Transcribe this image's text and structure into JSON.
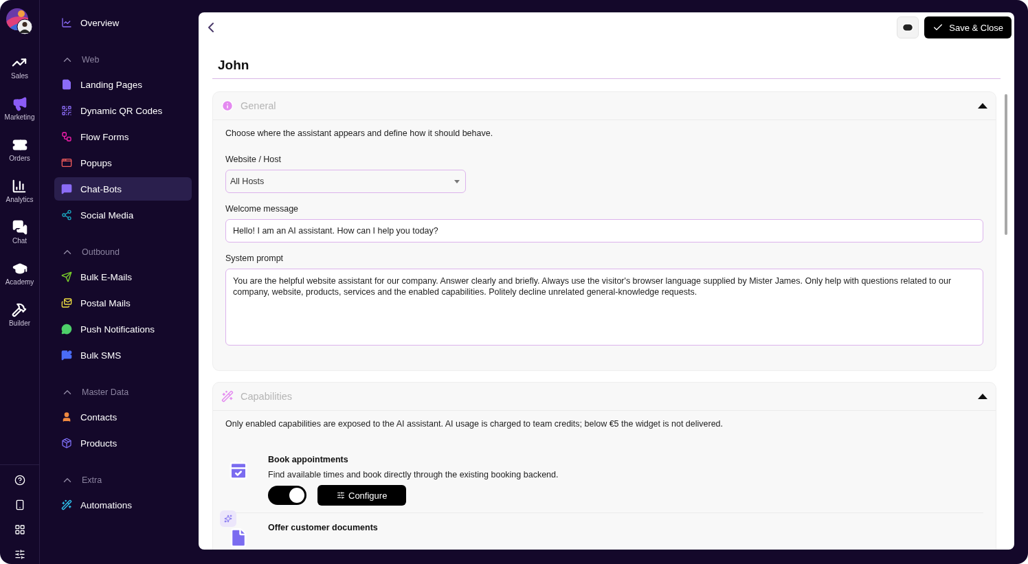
{
  "rail": {
    "items": [
      {
        "kind": "sales",
        "label": "Sales"
      },
      {
        "kind": "marketing",
        "label": "Marketing"
      },
      {
        "kind": "orders",
        "label": "Orders"
      },
      {
        "kind": "analytics",
        "label": "Analytics"
      },
      {
        "kind": "chat",
        "label": "Chat"
      },
      {
        "kind": "academy",
        "label": "Academy"
      },
      {
        "kind": "builder",
        "label": "Builder"
      }
    ],
    "bottom": [
      {
        "kind": "help"
      },
      {
        "kind": "phone"
      },
      {
        "kind": "apps"
      },
      {
        "kind": "sliders"
      }
    ]
  },
  "nav": [
    {
      "kind": "overview",
      "label": "Overview",
      "selected": false
    },
    {
      "kind": "group",
      "label": "Web",
      "expanded": true,
      "children": [
        {
          "kind": "landing",
          "label": "Landing Pages",
          "selected": false
        },
        {
          "kind": "qr",
          "label": "Dynamic QR Codes",
          "selected": false
        },
        {
          "kind": "flow",
          "label": "Flow Forms",
          "selected": false
        },
        {
          "kind": "popup",
          "label": "Popups",
          "selected": false
        },
        {
          "kind": "chatbot",
          "label": "Chat-Bots",
          "selected": true
        },
        {
          "kind": "social",
          "label": "Social Media",
          "selected": false
        }
      ]
    },
    {
      "kind": "group",
      "label": "Outbound",
      "expanded": true,
      "children": [
        {
          "kind": "email",
          "label": "Bulk E-Mails",
          "selected": false
        },
        {
          "kind": "postal",
          "label": "Postal Mails",
          "selected": false
        },
        {
          "kind": "push",
          "label": "Push Notifications",
          "selected": false
        },
        {
          "kind": "sms",
          "label": "Bulk SMS",
          "selected": false
        }
      ]
    },
    {
      "kind": "group",
      "label": "Master Data",
      "expanded": true,
      "children": [
        {
          "kind": "contacts",
          "label": "Contacts",
          "selected": false
        },
        {
          "kind": "products",
          "label": "Products",
          "selected": false
        }
      ]
    },
    {
      "kind": "group",
      "label": "Extra",
      "expanded": true,
      "children": [
        {
          "kind": "automations",
          "label": "Automations",
          "selected": false
        }
      ]
    }
  ],
  "header": {
    "save_button": "Save & Close",
    "title": "John"
  },
  "sections": [
    {
      "kind": "general",
      "title": "General",
      "expanded": true,
      "description": "Choose where the assistant appears and define how it should behave.",
      "fields": [
        {
          "kind": "select",
          "label": "Website / Host",
          "value": "All Hosts"
        },
        {
          "kind": "input",
          "label": "Welcome message",
          "value": "Hello! I am an AI assistant. How can I help you today?"
        },
        {
          "kind": "textarea",
          "label": "System prompt",
          "value": "You are the helpful website assistant for our company. Answer clearly and briefly. Always use the visitor's browser language supplied by Mister James. Only help with questions related to our company, website, products, services and the enabled capabilities. Politely decline unrelated general-knowledge requests."
        }
      ]
    },
    {
      "kind": "capabilities",
      "title": "Capabilities",
      "expanded": true,
      "description": "Only enabled capabilities are exposed to the AI assistant. AI usage is charged to team credits; below €5 the widget is not delivered.",
      "capabilities": [
        {
          "kind": "calendar",
          "title": "Book appointments",
          "description": "Find available times and book directly through the existing booking backend.",
          "enabled": true,
          "configure_button": "Configure"
        },
        {
          "kind": "document",
          "title": "Offer customer documents"
        }
      ]
    }
  ]
}
